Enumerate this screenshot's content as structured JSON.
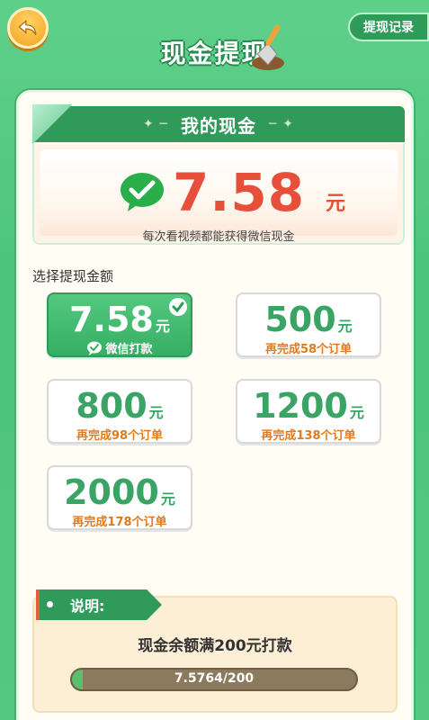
{
  "header": {
    "title": "现金提现",
    "record_label": "提现记录"
  },
  "cash": {
    "banner_title": "我的现金",
    "amount": "7.58",
    "unit": "元",
    "tip": "每次看视频都能获得微信现金"
  },
  "select_title": "选择提现金额",
  "options": [
    {
      "amount": "7.58",
      "unit": "元",
      "sub": "微信打款",
      "selected": true
    },
    {
      "amount": "500",
      "unit": "元",
      "sub": "再完成58个订单",
      "selected": false
    },
    {
      "amount": "800",
      "unit": "元",
      "sub": "再完成98个订单",
      "selected": false
    },
    {
      "amount": "1200",
      "unit": "元",
      "sub": "再完成138个订单",
      "selected": false
    },
    {
      "amount": "2000",
      "unit": "元",
      "sub": "再完成178个订单",
      "selected": false
    }
  ],
  "explain": {
    "tag": "说明:",
    "text": "现金余额满200元打款",
    "progress_text": "7.5764/200",
    "progress_fraction": 0.038
  },
  "colors": {
    "brand_green": "#2f9a5a",
    "amount_red": "#e64f3a",
    "orange": "#e07a1e"
  },
  "icons": [
    "back-arrow-icon",
    "wechat-icon",
    "check-icon",
    "shovel-icon"
  ]
}
